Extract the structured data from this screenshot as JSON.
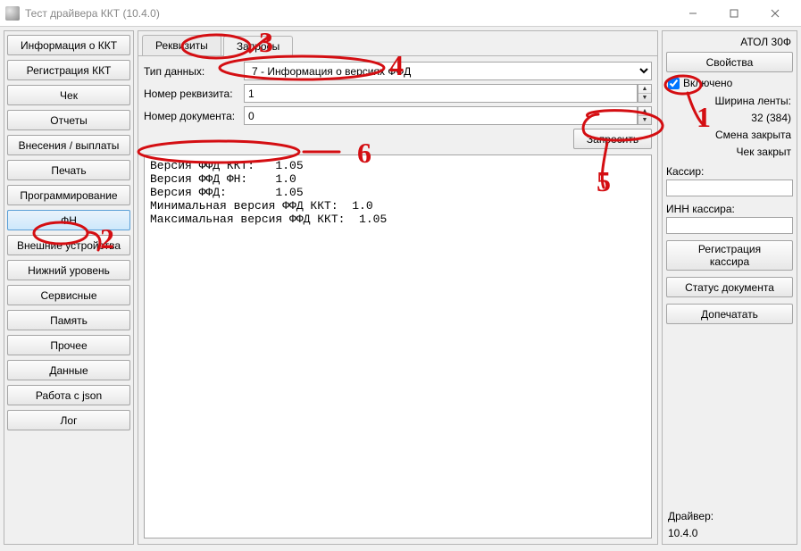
{
  "window": {
    "title": "Тест драйвера ККТ (10.4.0)"
  },
  "sidebar": {
    "items": [
      "Информация о ККТ",
      "Регистрация ККТ",
      "Чек",
      "Отчеты",
      "Внесения / выплаты",
      "Печать",
      "Программирование",
      "ФН",
      "Внешние устройства",
      "Нижний уровень",
      "Сервисные",
      "Память",
      "Прочее",
      "Данные",
      "Работа с json",
      "Лог"
    ],
    "active_index": 7
  },
  "tabs": {
    "items": [
      "Реквизиты",
      "Запросы"
    ],
    "active_index": 1
  },
  "form": {
    "type_label": "Тип данных:",
    "type_value": "7 - Информация о версиях ФФД",
    "reqnum_label": "Номер реквизита:",
    "reqnum_value": "1",
    "docnum_label": "Номер документа:",
    "docnum_value": "0",
    "request_button": "Запросить"
  },
  "output_lines": [
    "Версия ФФД ККТ:   1.05",
    "Версия ФФД ФН:    1.0",
    "Версия ФФД:       1.05",
    "Минимальная версия ФФД ККТ:  1.0",
    "Максимальная версия ФФД ККТ:  1.05"
  ],
  "right": {
    "device_name": "АТОЛ 30Ф",
    "properties_btn": "Свойства",
    "enabled_label": "Включено",
    "enabled_checked": true,
    "tape_width_label": "Ширина ленты:",
    "tape_width_value": "32 (384)",
    "shift_closed": "Смена закрыта",
    "check_closed": "Чек закрыт",
    "cashier_label": "Кассир:",
    "cashier_value": "",
    "cashier_inn_label": "ИНН кассира:",
    "cashier_inn_value": "",
    "reg_cashier_btn": "Регистрация\nкассира",
    "doc_status_btn": "Статус документа",
    "reprint_btn": "Допечатать",
    "driver_label": "Драйвер:",
    "driver_version": "10.4.0"
  },
  "annotations": {
    "color": "#d40e12",
    "marks": [
      "1",
      "2",
      "3",
      "4",
      "5",
      "6"
    ]
  }
}
